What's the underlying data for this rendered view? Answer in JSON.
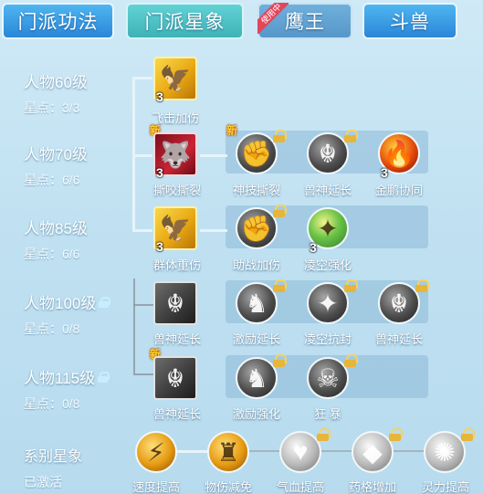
{
  "tabs": [
    {
      "label": "门派功法",
      "style": "blue"
    },
    {
      "label": "门派星象",
      "style": "active"
    },
    {
      "label": "鹰王",
      "style": "dim",
      "ribbon": "使用中"
    },
    {
      "label": "斗兽",
      "style": "blue"
    }
  ],
  "rows": [
    {
      "level": "人物60级",
      "stars": "星点：3/3",
      "locked": false
    },
    {
      "level": "人物70级",
      "stars": "星点：6/6",
      "locked": false
    },
    {
      "level": "人物85级",
      "stars": "星点：6/6",
      "locked": false
    },
    {
      "level": "人物100级",
      "stars": "星点：0/8",
      "locked": true
    },
    {
      "level": "人物115级",
      "stars": "星点：0/8",
      "locked": true
    }
  ],
  "skills": {
    "r1_main": {
      "name": "飞击加伤",
      "count": "3",
      "icon": "eagle-icon"
    },
    "r2_main": {
      "name": "撕咬撕裂",
      "count": "3",
      "icon": "beast-icon",
      "tag": "新"
    },
    "r2_1": {
      "name": "神技撕裂",
      "icon": "strike-icon"
    },
    "r2_2": {
      "name": "兽神延长",
      "icon": "spirit-icon"
    },
    "r2_3": {
      "name": "金鹏协同",
      "count": "3",
      "icon": "flame-icon"
    },
    "r3_main": {
      "name": "群体重伤",
      "count": "3",
      "icon": "eagle-icon"
    },
    "r3_1": {
      "name": "助战加伤",
      "icon": "strike-icon"
    },
    "r3_2": {
      "name": "凌空强化",
      "count": "3",
      "icon": "wing-icon"
    },
    "r4_main": {
      "name": "兽神延长",
      "icon": "spirit-icon"
    },
    "r4_1": {
      "name": "激励延长",
      "icon": "warrior-icon"
    },
    "r4_2": {
      "name": "凌空抗封",
      "icon": "wing-icon"
    },
    "r4_3": {
      "name": "兽神延长",
      "icon": "spirit-icon"
    },
    "r5_main": {
      "name": "兽神延长",
      "icon": "spirit-icon",
      "tag": "新"
    },
    "r5_1": {
      "name": "激励强化",
      "icon": "warrior-icon"
    },
    "r5_2": {
      "name": "狂 暴",
      "icon": "demon-mask-icon"
    }
  },
  "footer": {
    "title": "系别星象",
    "status": "已激活",
    "items": [
      {
        "name": "速度提高",
        "icon": "speed-icon"
      },
      {
        "name": "物伤减免",
        "icon": "armor-icon"
      },
      {
        "name": "气血提高",
        "icon": "heart-icon"
      },
      {
        "name": "药格增加",
        "icon": "gem-icon"
      },
      {
        "name": "灵力提高",
        "icon": "spark-icon"
      }
    ]
  },
  "colors": {
    "accent_line": "#e6f4fb",
    "gold": "#e9a915",
    "new_tag": "#ffcf2b"
  }
}
